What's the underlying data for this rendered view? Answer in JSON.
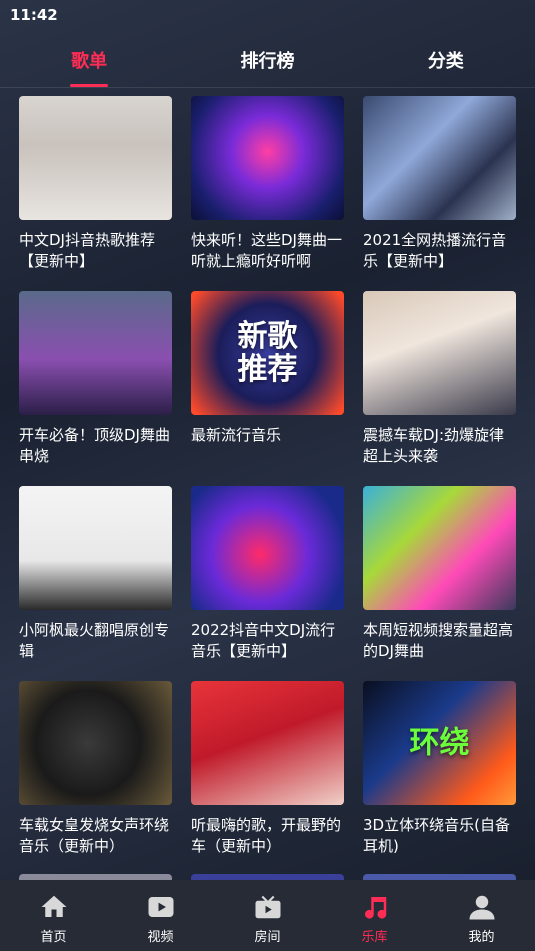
{
  "status_bar": {
    "time": "11:42"
  },
  "tabs": [
    {
      "label": "歌单",
      "active": true
    },
    {
      "label": "排行榜",
      "active": false
    },
    {
      "label": "分类",
      "active": false
    }
  ],
  "playlists": [
    {
      "title": "中文DJ抖音热歌推荐【更新中】",
      "cover_text": ""
    },
    {
      "title": "快来听！这些DJ舞曲一听就上瘾听好听啊",
      "cover_text": ""
    },
    {
      "title": "2021全网热播流行音乐【更新中】",
      "cover_text": ""
    },
    {
      "title": "开车必备！顶级DJ舞曲串烧",
      "cover_text": ""
    },
    {
      "title": "最新流行音乐",
      "cover_text": "新歌推荐"
    },
    {
      "title": "震撼车载DJ:劲爆旋律超上头来袭",
      "cover_text": ""
    },
    {
      "title": "小阿枫最火翻唱原创专辑",
      "cover_text": ""
    },
    {
      "title": "2022抖音中文DJ流行音乐【更新中】",
      "cover_text": ""
    },
    {
      "title": "本周短视频搜索量超高的DJ舞曲",
      "cover_text": ""
    },
    {
      "title": "车载女皇发烧女声环绕音乐（更新中）",
      "cover_text": ""
    },
    {
      "title": "听最嗨的歌，开最野的车（更新中）",
      "cover_text": ""
    },
    {
      "title": "3D立体环绕音乐(自备耳机)",
      "cover_text": "环绕"
    }
  ],
  "bottom_nav": [
    {
      "label": "首页",
      "icon": "home-icon",
      "active": false
    },
    {
      "label": "视频",
      "icon": "video-icon",
      "active": false
    },
    {
      "label": "房间",
      "icon": "room-icon",
      "active": false
    },
    {
      "label": "乐库",
      "icon": "music-note-icon",
      "active": true
    },
    {
      "label": "我的",
      "icon": "user-icon",
      "active": false
    }
  ],
  "colors": {
    "accent": "#ff2d55",
    "nav_bg": "#262b36"
  }
}
